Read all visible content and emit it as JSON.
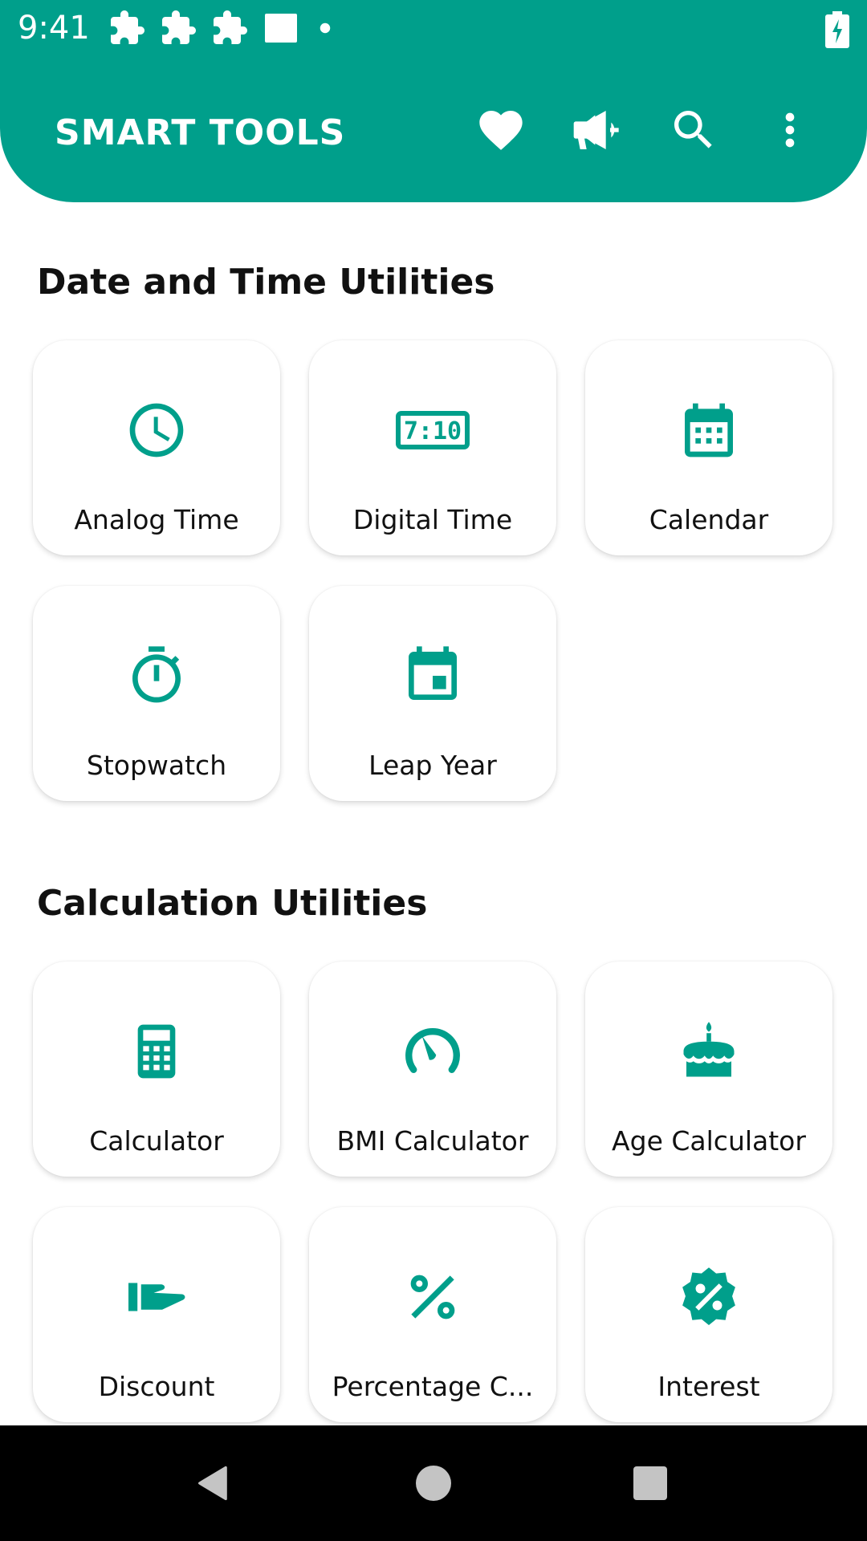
{
  "status": {
    "time": "9:41"
  },
  "app": {
    "title": "SMART TOOLS"
  },
  "colors": {
    "accent": "#009f8b",
    "nav": "#000000"
  },
  "actions": [
    "heart-icon",
    "megaphone-icon",
    "search-icon",
    "more-vert-icon"
  ],
  "sections": [
    {
      "title": "Date and Time Utilities",
      "items": [
        {
          "label": "Analog Time",
          "icon": "analog-clock-icon"
        },
        {
          "label": "Digital Time",
          "icon": "digital-clock-icon"
        },
        {
          "label": "Calendar",
          "icon": "calendar-icon"
        },
        {
          "label": "Stopwatch",
          "icon": "stopwatch-icon"
        },
        {
          "label": "Leap Year",
          "icon": "calendar-event-icon"
        }
      ]
    },
    {
      "title": "Calculation Utilities",
      "items": [
        {
          "label": "Calculator",
          "icon": "calculator-icon"
        },
        {
          "label": "BMI Calculator",
          "icon": "speedometer-icon"
        },
        {
          "label": "Age Calculator",
          "icon": "cake-icon"
        },
        {
          "label": "Discount",
          "icon": "hand-discount-icon"
        },
        {
          "label": "Percentage C...",
          "icon": "percent-icon"
        },
        {
          "label": "Interest",
          "icon": "percent-badge-icon"
        }
      ]
    }
  ],
  "navbar": [
    "back-icon",
    "home-icon",
    "recents-icon"
  ]
}
